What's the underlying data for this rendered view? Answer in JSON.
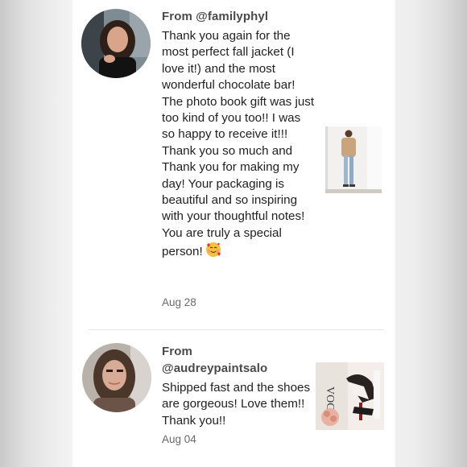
{
  "reviews": [
    {
      "from": "From @familyphyl",
      "text": "Thank you again for the most perfect fall jacket (I love it!) and the most wonderful chocolate bar! The photo book gift was just too kind of you too!! I was so happy to receive it!!! Thank you so much and Thank you for making my day! Your packaging is beautiful and so inspiring with your thoughtful notes! You are truly a special person!",
      "emoji": "smiling-face-with-hearts",
      "date": "Aug 28"
    },
    {
      "from_label": "From",
      "from_user": "@audreypaintsalo",
      "text": "Shipped fast and the shoes are gorgeous! Love them!! Thank you!!",
      "date": "Aug 04",
      "thumb_magazine_text": "VOGUE"
    }
  ]
}
